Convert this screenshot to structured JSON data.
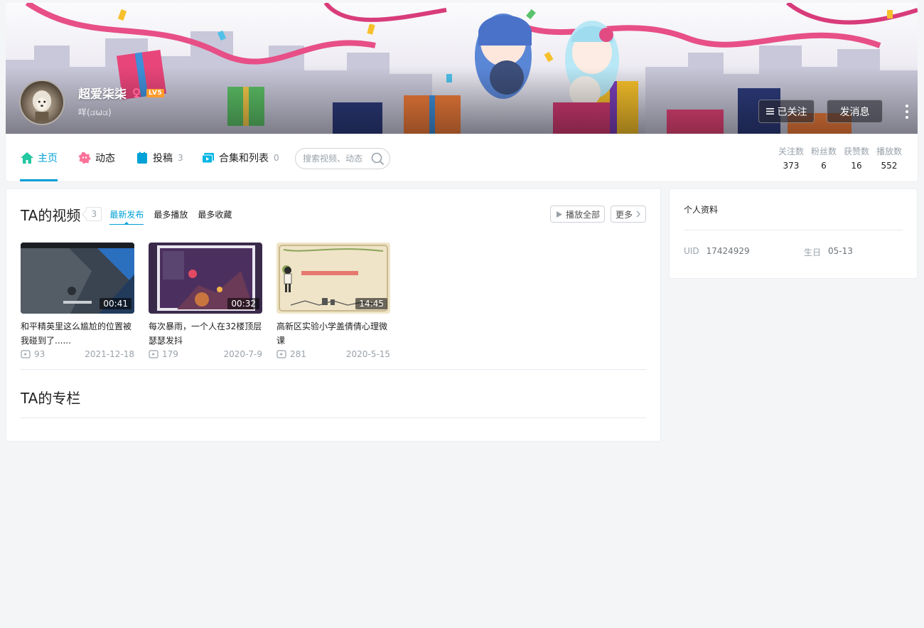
{
  "header": {
    "username": "超爱柒柒",
    "gender": "female",
    "level": "LV5",
    "signature": "咩(ಡωಡ)",
    "follow_label": "已关注",
    "message_label": "发消息",
    "more_icon": "more-dots-icon"
  },
  "nav": {
    "tabs": [
      {
        "label": "主页",
        "icon": "home-icon",
        "active": true
      },
      {
        "label": "动态",
        "icon": "dynamic-icon"
      },
      {
        "label": "投稿",
        "icon": "upload-icon",
        "count": "3"
      },
      {
        "label": "合集和列表",
        "icon": "collection-icon",
        "count": "0"
      }
    ],
    "search_placeholder": "搜索视频、动态",
    "stats": [
      {
        "label": "关注数",
        "value": "373"
      },
      {
        "label": "粉丝数",
        "value": "6"
      },
      {
        "label": "获赞数",
        "value": "16"
      },
      {
        "label": "播放数",
        "value": "552"
      }
    ]
  },
  "videos_section": {
    "title": "TA的视频",
    "count": "3",
    "sort_tabs": [
      "最新发布",
      "最多播放",
      "最多收藏"
    ],
    "play_all_label": "播放全部",
    "more_label": "更多",
    "items": [
      {
        "title": "和平精英里这么尴尬的位置被我碰到了......",
        "duration": "00:41",
        "plays": "93",
        "date": "2021-12-18"
      },
      {
        "title": "每次暴雨，一个人在32楼顶层瑟瑟发抖",
        "duration": "00:32",
        "plays": "179",
        "date": "2020-7-9"
      },
      {
        "title": "高新区实验小学盖倩倩心理微课",
        "duration": "14:45",
        "plays": "281",
        "date": "2020-5-15"
      }
    ]
  },
  "column_section": {
    "title": "TA的专栏"
  },
  "profile": {
    "title": "个人资料",
    "uid_label": "UID",
    "uid_value": "17424929",
    "birthday_label": "生日",
    "birthday_value": "05-13"
  },
  "colors": {
    "accent": "#00a1d6",
    "home_icon": "#23c7a0",
    "dynamic_icon": "#fb7299",
    "upload_icon": "#00a1d6",
    "collection_icon": "#00b5e5",
    "level_badge": "#ff9c2b",
    "gender_female": "#ff6699"
  }
}
